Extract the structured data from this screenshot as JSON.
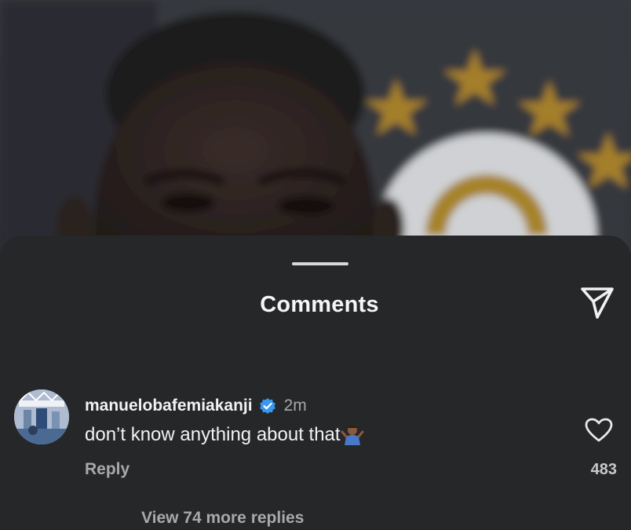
{
  "sheet": {
    "title": "Comments",
    "share_icon": "send-icon"
  },
  "comment": {
    "username": "manuelobafemiakanji",
    "verified_icon": "verified-badge-icon",
    "time": "2m",
    "text": "don’t know anything about that",
    "emoji_icon": "person-shrugging-emoji",
    "reply_label": "Reply",
    "like_icon": "heart-icon",
    "like_count": "483",
    "view_replies_label": "View 74 more replies"
  },
  "colors": {
    "sheet_bg": "#262729",
    "verified_blue": "#3897f0",
    "star_gold": "#b08a2c"
  }
}
